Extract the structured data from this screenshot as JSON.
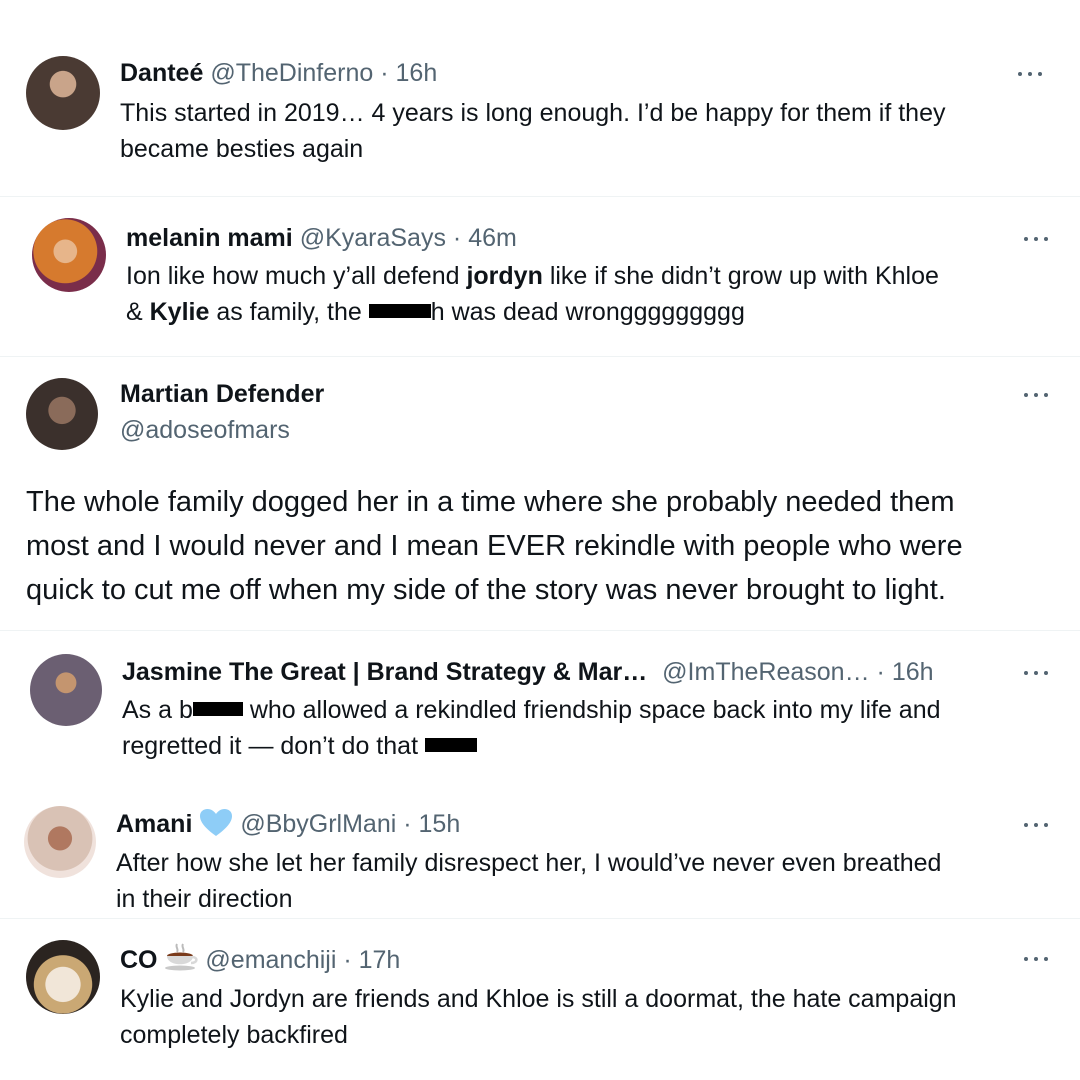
{
  "tweets": [
    {
      "name": "Danteé",
      "handle": "@TheDinferno",
      "dot": "·",
      "time": "16h",
      "line1": "This started in 2019… 4 years is long enough. I’d be happy for them if they",
      "line2": "became besties again"
    },
    {
      "name": "melanin mami",
      "handle": "@KyaraSays",
      "dot": "·",
      "time": "46m",
      "l1a": "Ion like how much y’all defend ",
      "l1b": "jordyn",
      "l1c": " like if she didn’t grow up with Khloe",
      "l2a": "& ",
      "l2b": "Kylie",
      "l2c": " as family, the ",
      "l2d": "h was dead wronggggggggg"
    },
    {
      "name": "Martian Defender",
      "handle": "@adoseofmars",
      "line1": "The whole family dogged her in a time where she probably needed them",
      "line2": "most and I would never and I mean EVER rekindle with people who were",
      "line3": "quick to cut me off when my side of the story was never brought to light."
    },
    {
      "name": "Jasmine The Great | Brand Strategy & Mar…",
      "handle": "@ImTheReason…",
      "dot": "·",
      "time": "16h",
      "l1a": "As a ",
      "l1b": "b",
      "l1c": " who allowed a rekindled friendship space back into my life and",
      "line2": "regretted it — don’t do that "
    },
    {
      "name": "Amani",
      "handle": "@BbyGrlMani",
      "dot": "·",
      "time": "15h",
      "line1": "After how she let her family disrespect her, I would’ve never even breathed",
      "line2": "in their direction"
    },
    {
      "name": "CO",
      "handle": "@emanchiji",
      "dot": "·",
      "time": "17h",
      "line1": "Kylie and Jordyn are friends and Khloe is still a doormat, the hate campaign",
      "line2": "completely backfired"
    }
  ],
  "icons": {
    "more": "more-options-icon",
    "verified": "blue-heart-emoji",
    "coffee": "hot-beverage-emoji"
  },
  "colors": {
    "text": "#0f1419",
    "secondary": "#536471",
    "heart": "#8ecdf7",
    "redaction": "#000000"
  }
}
